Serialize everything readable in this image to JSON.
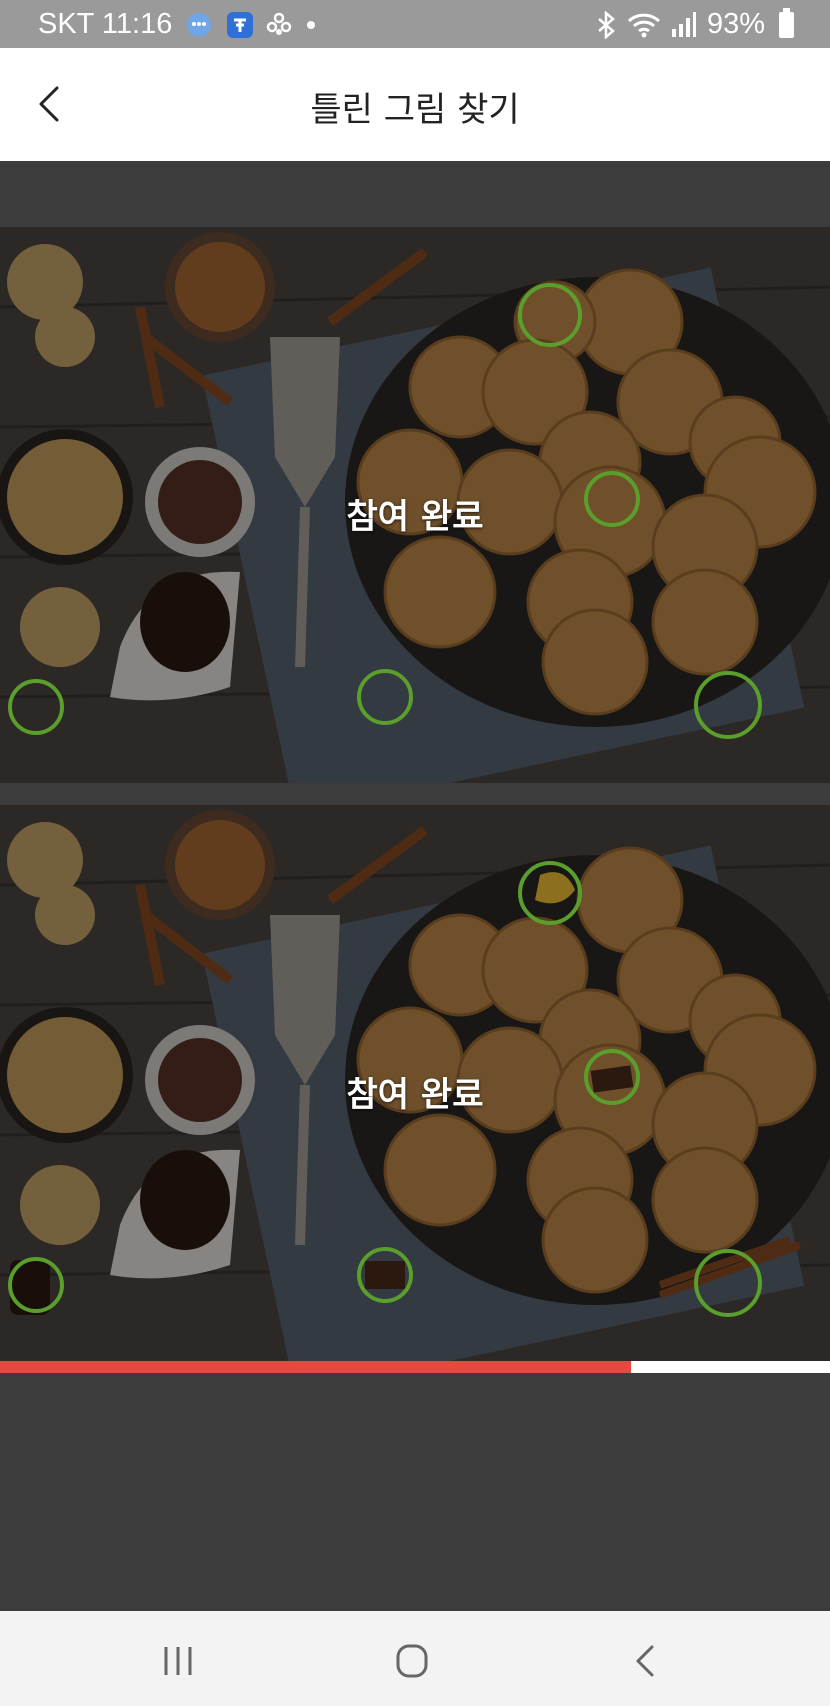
{
  "status_bar": {
    "carrier_time": "SKT 11:16",
    "battery_percent": "93%",
    "notification_icons": [
      "chat-bubble-icon",
      "app-badge-icon",
      "flower-icon",
      "dot-icon"
    ],
    "system_icons": [
      "bluetooth-icon",
      "wifi-icon",
      "signal-icon",
      "battery-icon"
    ]
  },
  "app_bar": {
    "title": "틀린 그림 찾기",
    "back_icon": "chevron-left-icon"
  },
  "game": {
    "top_image": {
      "overlay_label": "참여 완료"
    },
    "bottom_image": {
      "overlay_label": "참여 완료"
    },
    "found_marker_color": "#5a9e2c",
    "differences_found": 5,
    "progress": 0.76,
    "progress_color": "#e44b40"
  },
  "nav_bar": {
    "buttons": [
      "recents-icon",
      "home-icon",
      "back-icon"
    ]
  }
}
